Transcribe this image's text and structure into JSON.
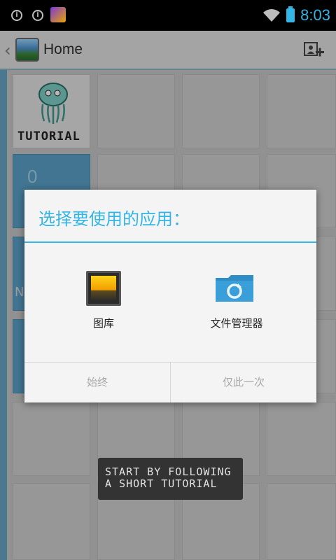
{
  "status_bar": {
    "time": "8:03",
    "notif_1": "i",
    "notif_2": "i"
  },
  "action_bar": {
    "title": "Home"
  },
  "grid": {
    "zero_label": "0",
    "n_label": "N"
  },
  "tutorial_tile": {
    "label": "TUTORIAL"
  },
  "tooltip": {
    "line1": "START BY FOLLOWING",
    "line2": "A SHORT TUTORIAL"
  },
  "dialog": {
    "title": "选择要使用的应用：",
    "apps": [
      {
        "label": "图库",
        "icon": "gallery-icon"
      },
      {
        "label": "文件管理器",
        "icon": "file-manager-icon"
      }
    ],
    "buttons": {
      "always": "始终",
      "just_once": "仅此一次"
    }
  },
  "colors": {
    "accent": "#33b5e5",
    "tile_blue": "#5aa3c9"
  }
}
